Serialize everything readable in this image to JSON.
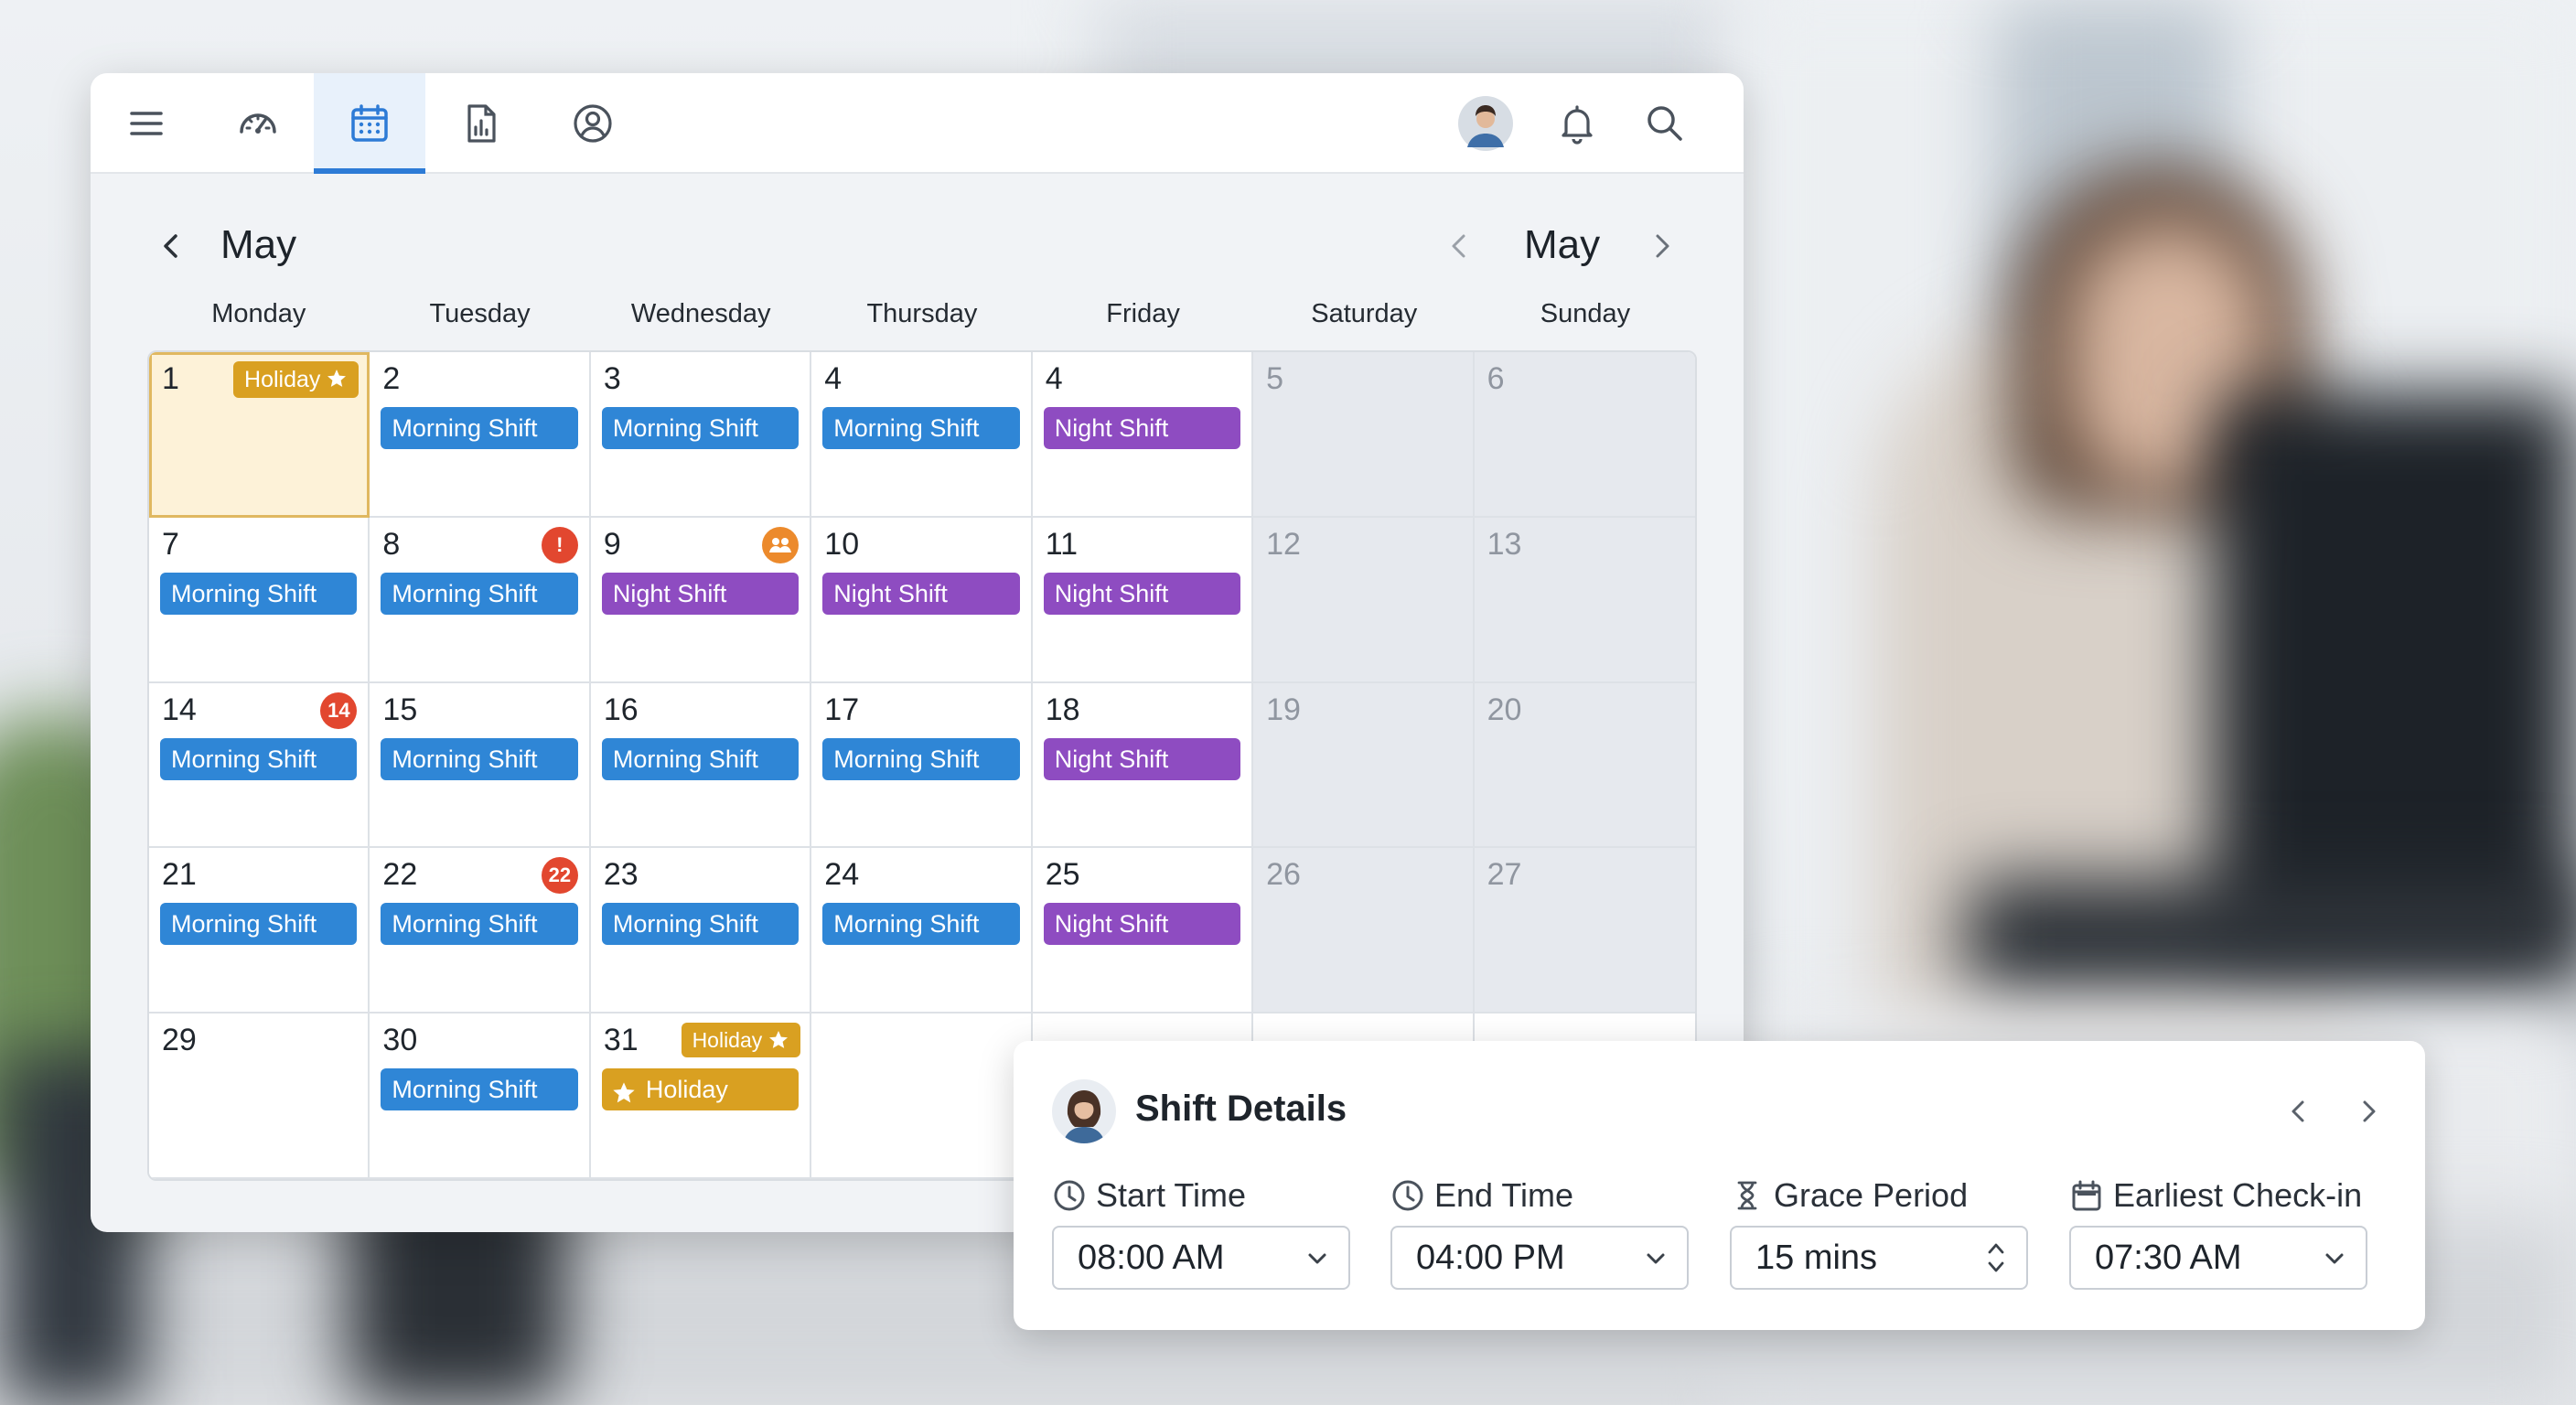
{
  "calendar": {
    "month_left": "May",
    "month_right": "May",
    "weekdays": [
      "Monday",
      "Tuesday",
      "Wednesday",
      "Thursday",
      "Friday",
      "Saturday",
      "Sunday"
    ],
    "weeks": [
      [
        {
          "day": "1",
          "tag": "Holiday"
        },
        {
          "day": "2",
          "shift": "Morning Shift"
        },
        {
          "day": "3",
          "shift": "Morning Shift"
        },
        {
          "day": "4",
          "shift": "Morning Shift"
        },
        {
          "day": "4",
          "shift": "Night Shift"
        },
        {
          "day": "5"
        },
        {
          "day": "6"
        }
      ],
      [
        {
          "day": "7",
          "shift": "Morning Shift"
        },
        {
          "day": "8",
          "shift": "Morning Shift",
          "badge": "!"
        },
        {
          "day": "9",
          "shift": "Night Shift"
        },
        {
          "day": "10",
          "shift": "Night Shift"
        },
        {
          "day": "11",
          "shift": "Night Shift"
        },
        {
          "day": "12"
        },
        {
          "day": "13"
        }
      ],
      [
        {
          "day": "14",
          "shift": "Morning Shift",
          "badge": "14"
        },
        {
          "day": "15",
          "shift": "Morning Shift"
        },
        {
          "day": "16",
          "shift": "Morning Shift"
        },
        {
          "day": "17",
          "shift": "Morning Shift"
        },
        {
          "day": "18",
          "shift": "Night Shift"
        },
        {
          "day": "19"
        },
        {
          "day": "20"
        }
      ],
      [
        {
          "day": "21",
          "shift": "Morning Shift"
        },
        {
          "day": "22",
          "shift": "Morning Shift",
          "badge": "22"
        },
        {
          "day": "23",
          "shift": "Morning Shift"
        },
        {
          "day": "24",
          "shift": "Morning Shift"
        },
        {
          "day": "25",
          "shift": "Night Shift"
        },
        {
          "day": "26"
        },
        {
          "day": "27"
        }
      ],
      [
        {
          "day": "29"
        },
        {
          "day": "30",
          "shift": "Morning Shift"
        },
        {
          "day": "31",
          "tag": "Holiday",
          "shift": "Holiday"
        }
      ]
    ]
  },
  "shift_details": {
    "title": "Shift Details",
    "start_time": {
      "label": "Start Time",
      "value": "08:00 AM"
    },
    "end_time": {
      "label": "End Time",
      "value": "04:00 PM"
    },
    "grace_period": {
      "label": "Grace Period",
      "value": "15 mins"
    },
    "earliest_checkin": {
      "label": "Earliest Check-in",
      "value": "07:30 AM"
    }
  },
  "colors": {
    "morning_shift": "#2f86d6",
    "night_shift": "#8e4cc1",
    "holiday": "#d9a021",
    "badge_red": "#e2472f",
    "badge_orange": "#ec8a2c",
    "accent": "#2d7bd6"
  },
  "icons": {
    "topbar_left": [
      "menu-icon",
      "dashboard-gauge-icon",
      "calendar-icon",
      "report-icon",
      "account-icon"
    ],
    "topbar_right": [
      "avatar",
      "bell-icon",
      "search-icon"
    ]
  }
}
